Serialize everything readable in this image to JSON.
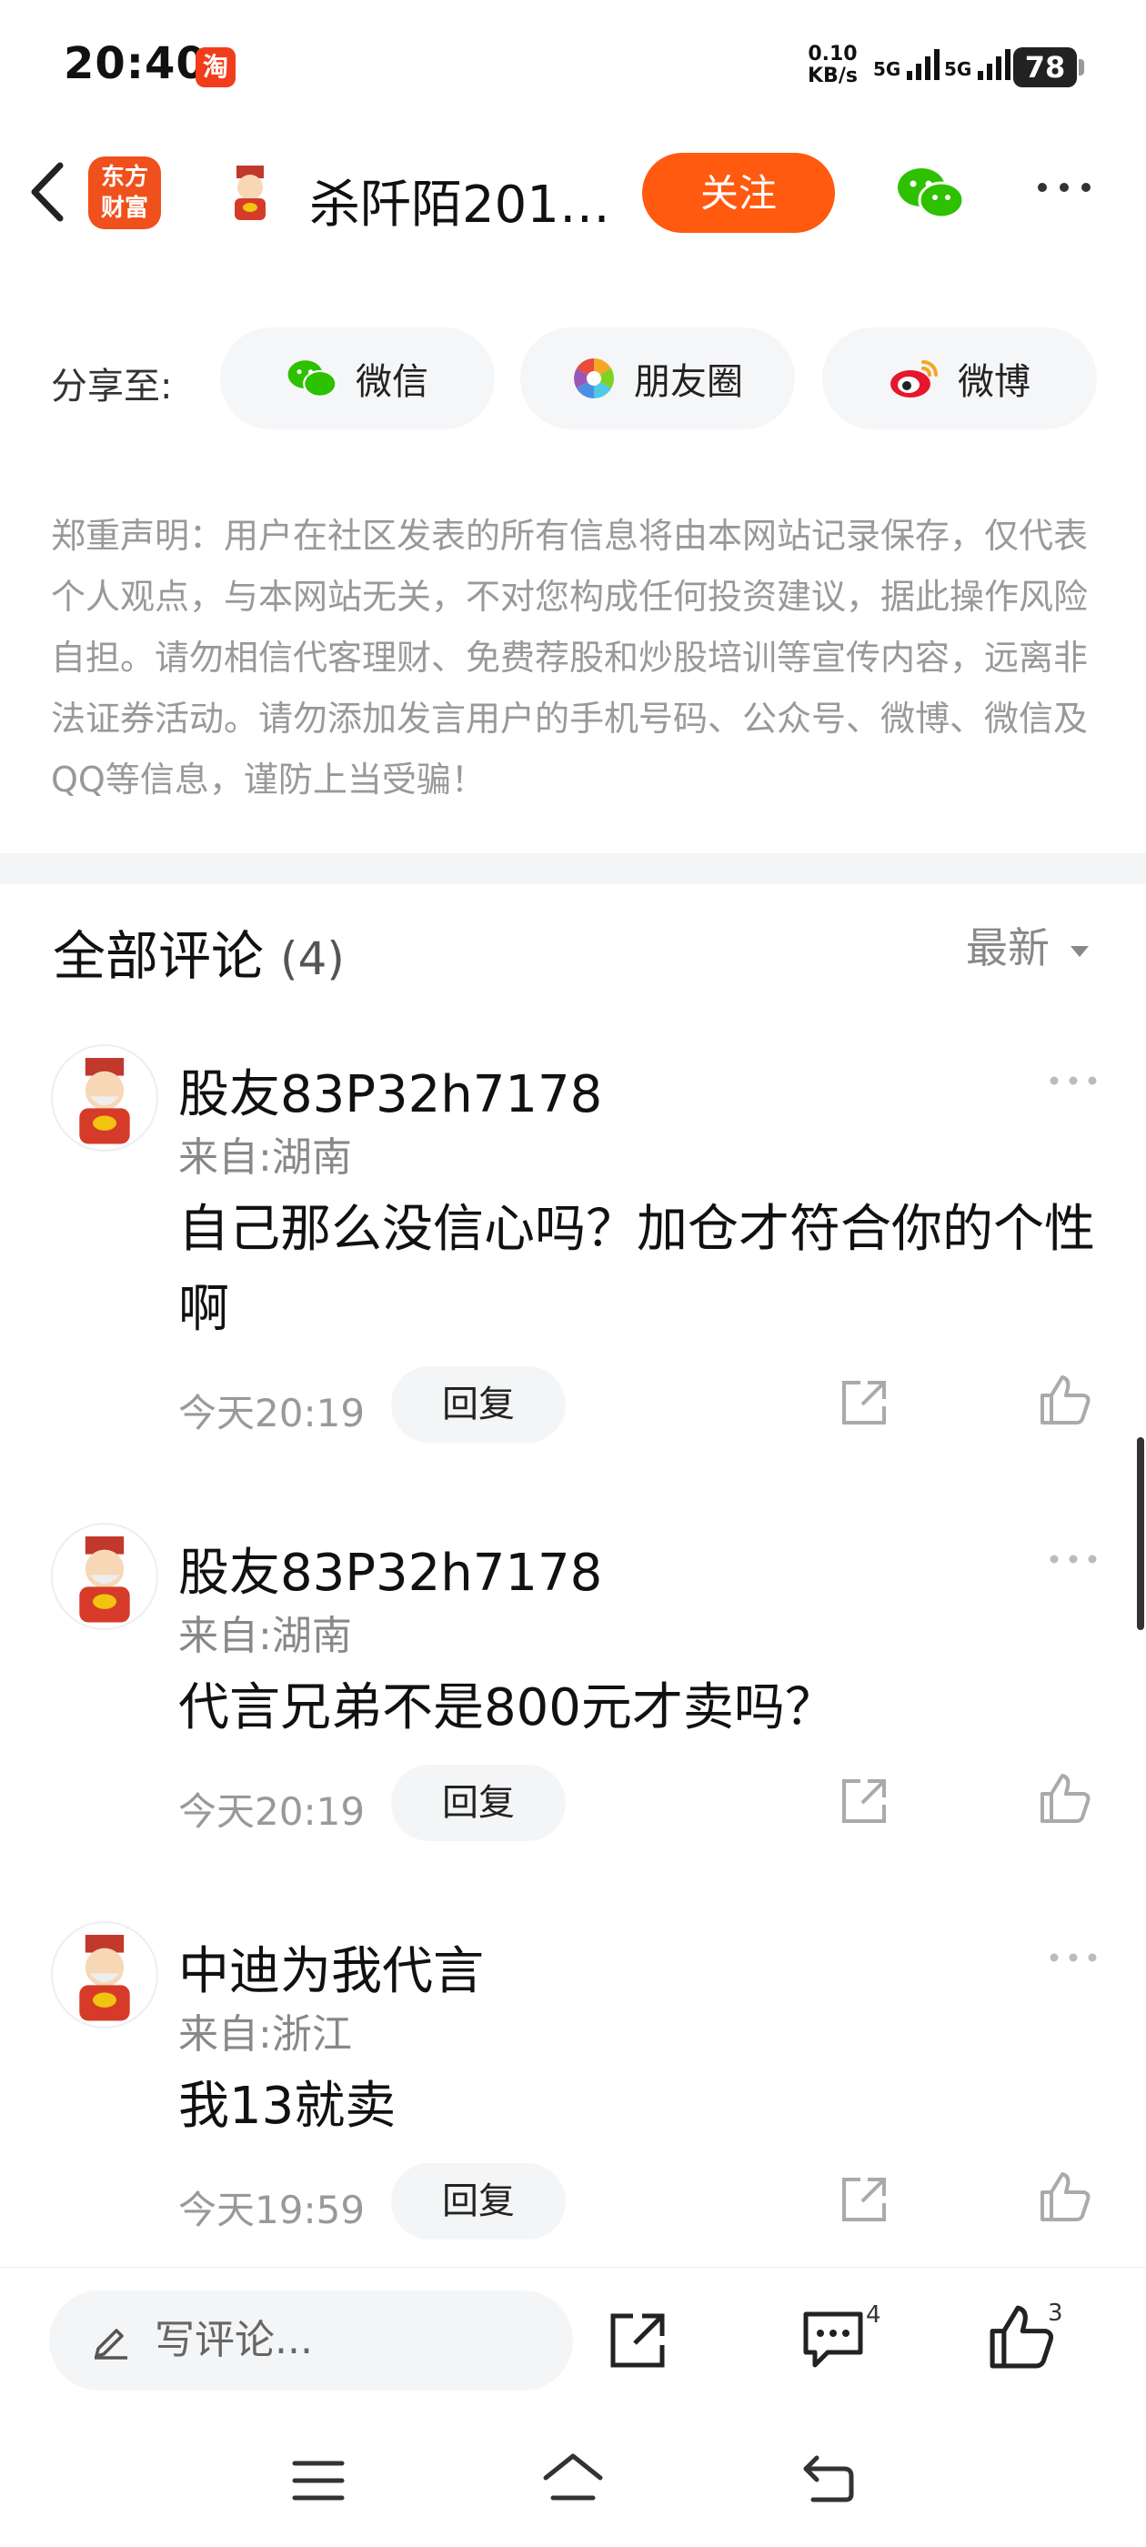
{
  "status_bar": {
    "time": "20:40",
    "app_icon": "淘",
    "net_speed_value": "0.10",
    "net_speed_unit": "KB/s",
    "sim1": "5G",
    "sim2": "5G",
    "battery": "78"
  },
  "header": {
    "logo_line1": "东方",
    "logo_line2": "财富",
    "title": "杀阡陌201…",
    "follow_label": "关注"
  },
  "share": {
    "label": "分享至:",
    "targets": [
      {
        "label": "微信",
        "icon": "wechat-icon"
      },
      {
        "label": "朋友圈",
        "icon": "moments-icon"
      },
      {
        "label": "微博",
        "icon": "weibo-icon"
      }
    ]
  },
  "disclaimer": "郑重声明：用户在社区发表的所有信息将由本网站记录保存，仅代表个人观点，与本网站无关，不对您构成任何投资建议，据此操作风险自担。请勿相信代客理财、免费荐股和炒股培训等宣传内容，远离非法证券活动。请勿添加发言用户的手机号码、公众号、微博、微信及QQ等信息，谨防上当受骗！",
  "comments_section": {
    "title": "全部评论",
    "count": "(4)",
    "sort_label": "最新"
  },
  "comments": [
    {
      "name": "股友83P32h7178",
      "location": "来自:湖南",
      "body": "自己那么没信心吗？加仓才符合你的个性啊",
      "time": "今天20:19",
      "reply_label": "回复"
    },
    {
      "name": "股友83P32h7178",
      "location": "来自:湖南",
      "body": "代言兄弟不是800元才卖吗？",
      "time": "今天20:19",
      "reply_label": "回复"
    },
    {
      "name": "中迪为我代言",
      "location": "来自:浙江",
      "body": "我13就卖",
      "time": "今天19:59",
      "reply_label": "回复"
    }
  ],
  "bottom_bar": {
    "write_placeholder": "写评论...",
    "comment_count": "4",
    "like_count": "3"
  },
  "colors": {
    "accent": "#ff5a10",
    "logo": "#f0501c",
    "muted_text": "#999999"
  }
}
